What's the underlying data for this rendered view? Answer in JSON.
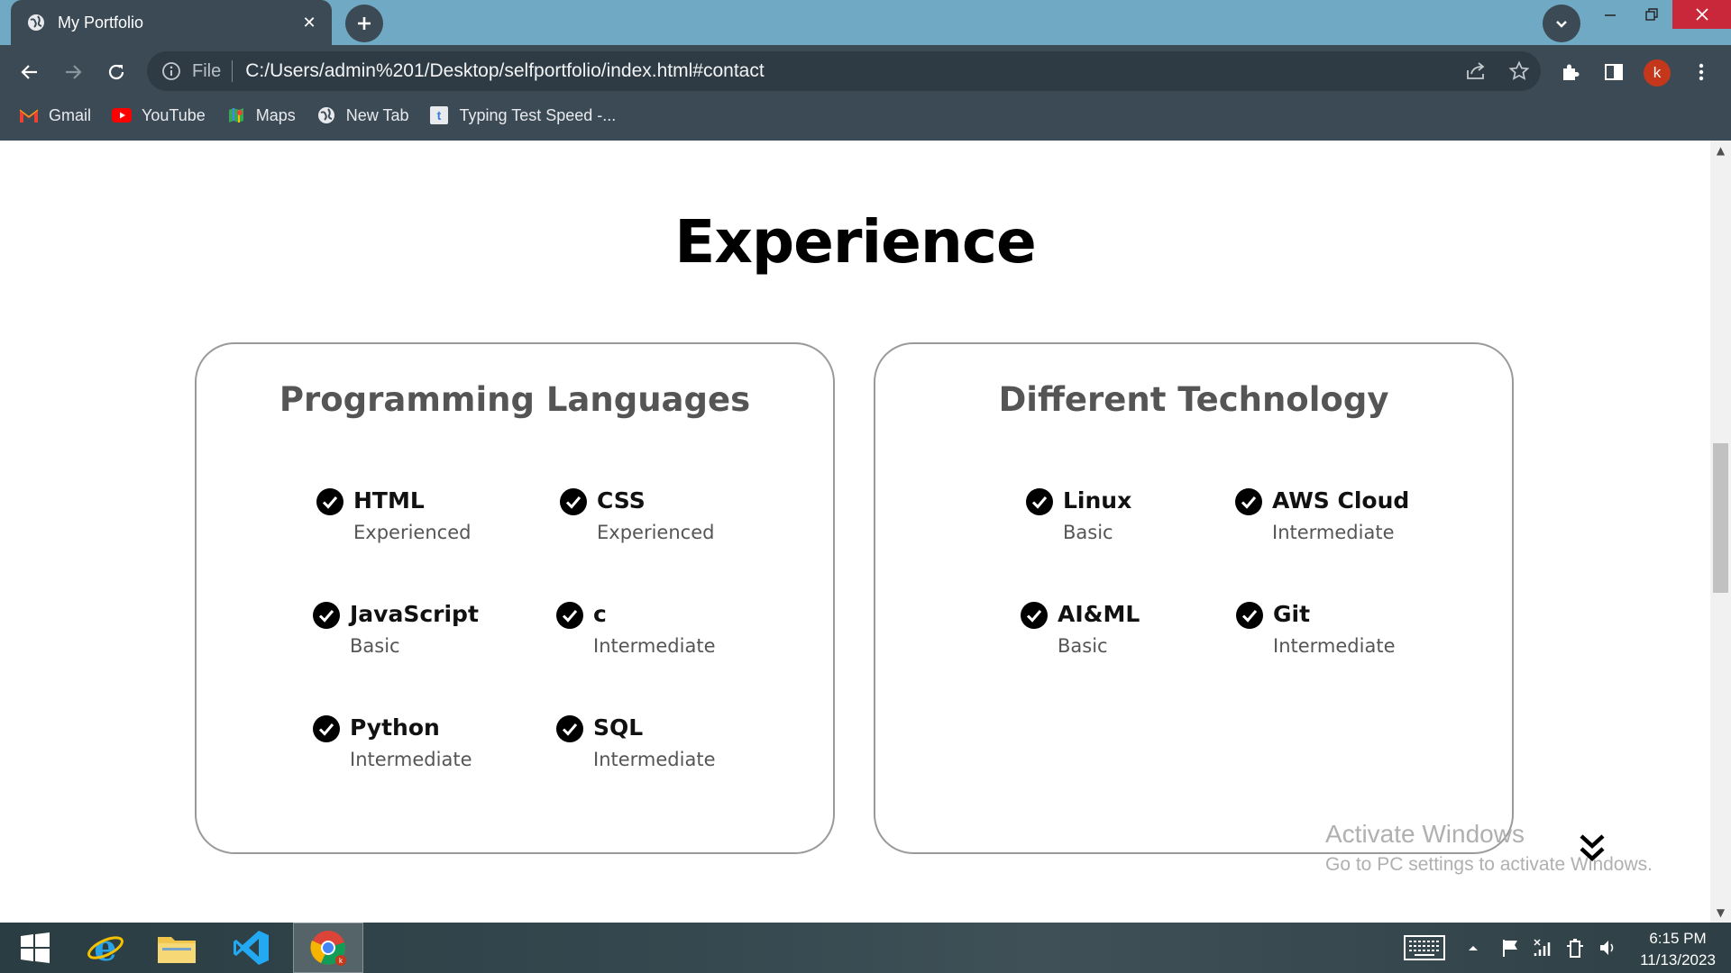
{
  "browser": {
    "tab_title": "My Portfolio",
    "tab_close": "✕",
    "new_tab": "+",
    "address_scheme": "File",
    "address_url": "C:/Users/admin%201/Desktop/selfportfolio/index.html#contact",
    "profile_initial": "k",
    "bookmarks": [
      {
        "label": "Gmail",
        "icon": "gmail-icon"
      },
      {
        "label": "YouTube",
        "icon": "youtube-icon"
      },
      {
        "label": "Maps",
        "icon": "maps-icon"
      },
      {
        "label": "New Tab",
        "icon": "globe-icon"
      },
      {
        "label": "Typing Test Speed -...",
        "icon": "typing-test-icon"
      }
    ]
  },
  "page": {
    "section_title": "Experience",
    "cards": [
      {
        "title": "Programming Languages",
        "skills": [
          {
            "name": "HTML",
            "level": "Experienced"
          },
          {
            "name": "CSS",
            "level": "Experienced"
          },
          {
            "name": "JavaScript",
            "level": "Basic"
          },
          {
            "name": "c",
            "level": "Intermediate"
          },
          {
            "name": "Python",
            "level": "Intermediate"
          },
          {
            "name": "SQL",
            "level": "Intermediate"
          }
        ]
      },
      {
        "title": "Different Technology",
        "skills": [
          {
            "name": "Linux",
            "level": "Basic"
          },
          {
            "name": "AWS Cloud",
            "level": "Intermediate"
          },
          {
            "name": "AI&ML",
            "level": "Basic"
          },
          {
            "name": "Git",
            "level": "Intermediate"
          }
        ]
      }
    ],
    "watermark_line1": "Activate Windows",
    "watermark_line2": "Go to PC settings to activate Windows."
  },
  "taskbar": {
    "time": "6:15 PM",
    "date": "11/13/2023"
  },
  "colors": {
    "titlebar": "#70a9c3",
    "toolbar": "#3c4a55",
    "close_button": "#c8283a",
    "card_border": "#9a9a9a"
  }
}
